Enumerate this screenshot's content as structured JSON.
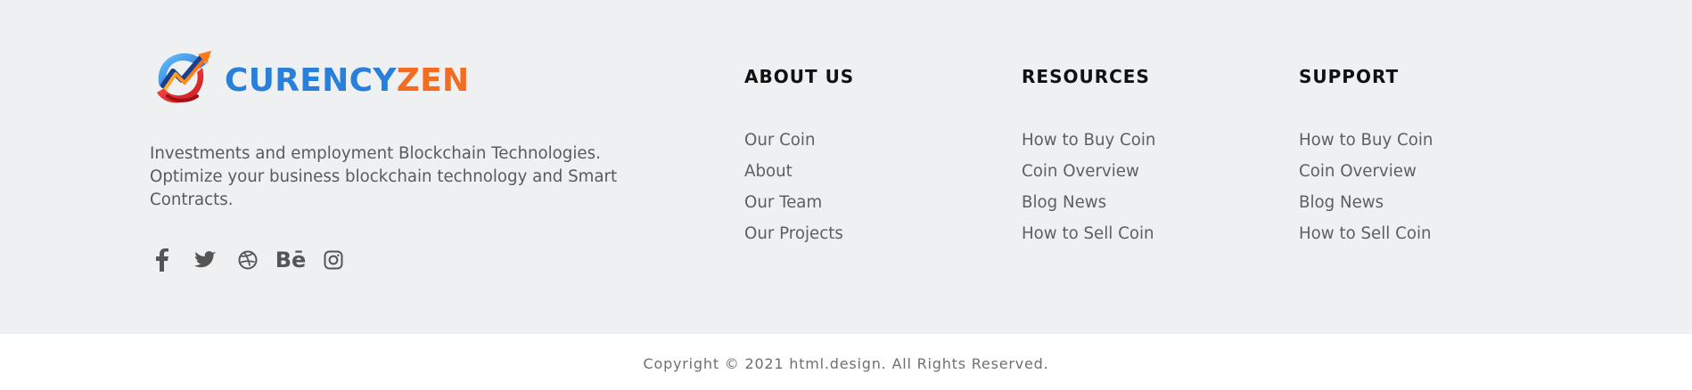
{
  "brand": {
    "name_part_a": "CURENCY",
    "name_part_b": "ZEN",
    "colors": {
      "blue": "#2a7fd9",
      "orange": "#f26d21",
      "red": "#e53935"
    }
  },
  "footer": {
    "about_text": "Investments and employment Blockchain Technologies. Optimize your business blockchain technology and Smart Contracts.",
    "social_links": [
      {
        "icon": "facebook-icon"
      },
      {
        "icon": "twitter-icon"
      },
      {
        "icon": "dribbble-icon"
      },
      {
        "icon": "behance-icon",
        "label": "Bē"
      },
      {
        "icon": "instagram-icon"
      }
    ],
    "columns": [
      {
        "title": "ABOUT US",
        "links": [
          "Our Coin",
          "About",
          "Our Team",
          "Our Projects"
        ]
      },
      {
        "title": "RESOURCES",
        "links": [
          "How to Buy Coin",
          "Coin Overview",
          "Blog News",
          "How to Sell Coin"
        ]
      },
      {
        "title": "SUPPORT",
        "links": [
          "How to Buy Coin",
          "Coin Overview",
          "Blog News",
          "How to Sell Coin"
        ]
      }
    ],
    "copyright": "Copyright © 2021 html.design. All Rights Reserved."
  }
}
